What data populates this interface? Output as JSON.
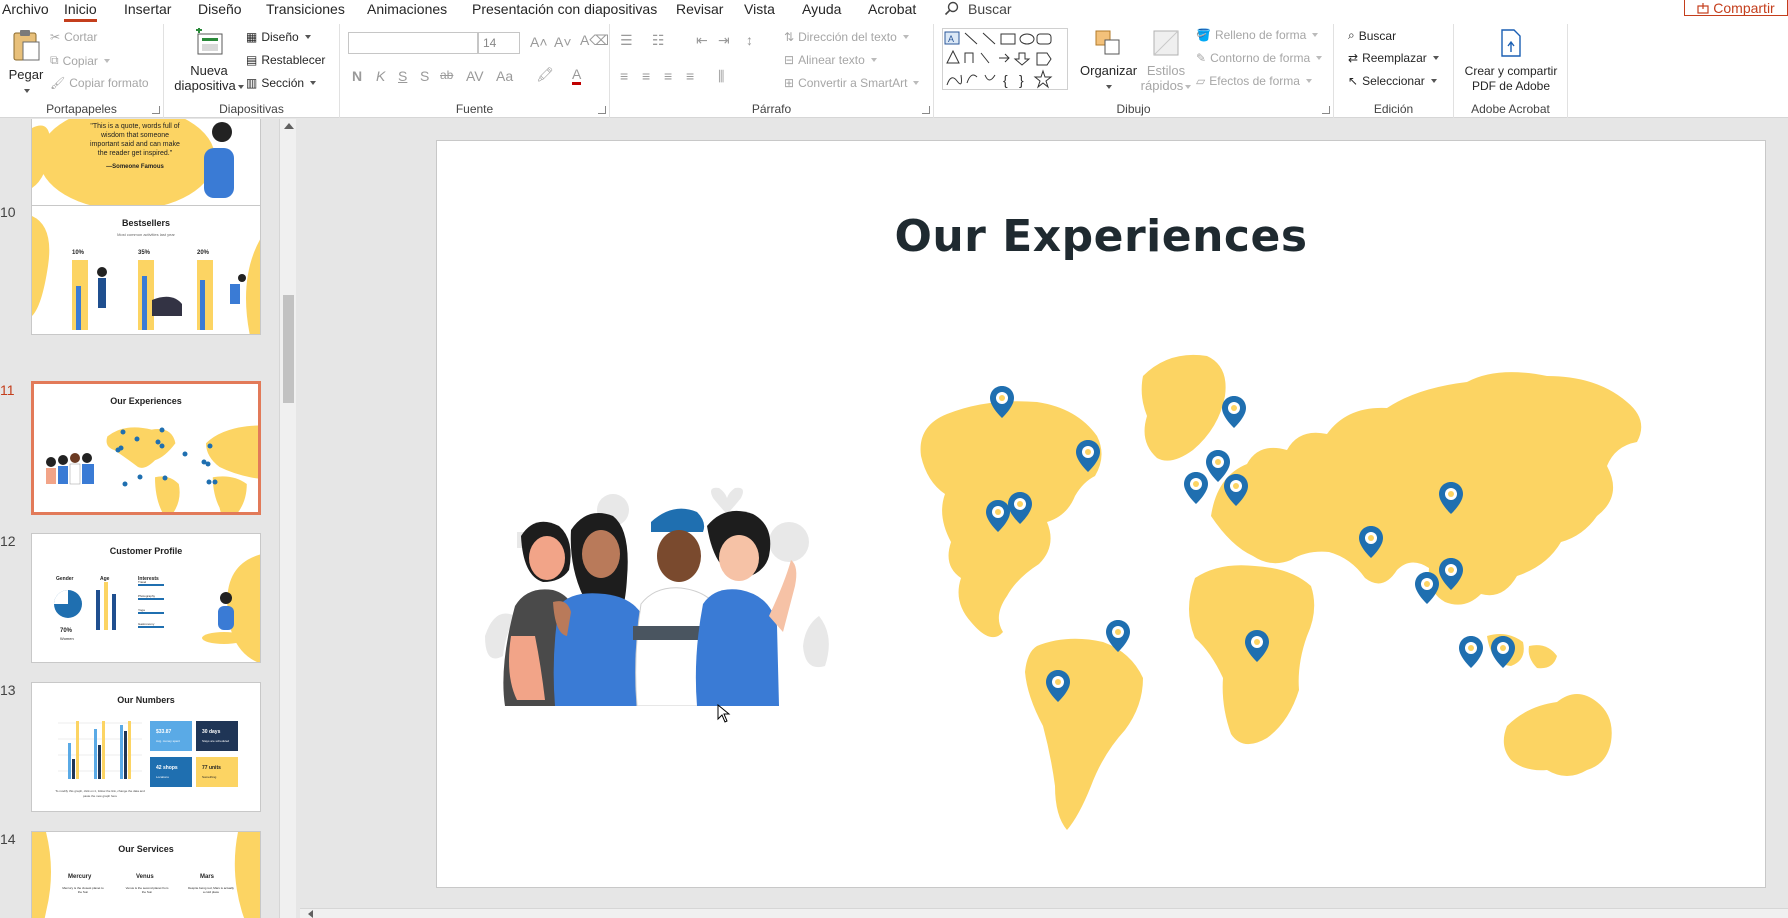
{
  "menu": {
    "tabs": [
      "Archivo",
      "Inicio",
      "Insertar",
      "Diseño",
      "Transiciones",
      "Animaciones",
      "Presentación con diapositivas",
      "Revisar",
      "Vista",
      "Ayuda",
      "Acrobat"
    ],
    "active_index": 1,
    "search_label": "Buscar",
    "share_label": "Compartir"
  },
  "ribbon": {
    "clipboard": {
      "paste": "Pegar",
      "cut": "Cortar",
      "copy": "Copiar",
      "format_painter": "Copiar formato",
      "label": "Portapapeles"
    },
    "slides": {
      "new_slide_line1": "Nueva",
      "new_slide_line2": "diapositiva",
      "layout": "Diseño",
      "reset": "Restablecer",
      "section": "Sección",
      "label": "Diapositivas"
    },
    "font": {
      "font_name": "",
      "font_size": "14",
      "bold": "N",
      "italic": "K",
      "underline": "S",
      "shadow": "S",
      "strike": "ab",
      "label": "Fuente"
    },
    "paragraph": {
      "text_direction": "Dirección del texto",
      "align_text": "Alinear texto",
      "smartart": "Convertir a SmartArt",
      "label": "Párrafo"
    },
    "drawing": {
      "arrange": "Organizar",
      "quick_styles_line1": "Estilos",
      "quick_styles_line2": "rápidos",
      "shape_fill": "Relleno de forma",
      "shape_outline": "Contorno de forma",
      "shape_effects": "Efectos de forma",
      "label": "Dibujo"
    },
    "editing": {
      "find": "Buscar",
      "replace": "Reemplazar",
      "select": "Seleccionar",
      "label": "Edición"
    },
    "acrobat": {
      "create_line1": "Crear y compartir",
      "create_line2": "PDF de Adobe",
      "label": "Adobe Acrobat"
    }
  },
  "thumbnails": [
    {
      "number": "",
      "title": "",
      "quote": "\"This is a quote, words full of wisdom that someone important said and can make the reader get inspired.\"",
      "author": "—Someone Famous"
    },
    {
      "number": "10",
      "title": "Bestsellers",
      "subtitle": "Most common activities last year",
      "bars": [
        {
          "label": "10%"
        },
        {
          "label": "35%"
        },
        {
          "label": "20%"
        }
      ]
    },
    {
      "number": "11",
      "title": "Our Experiences",
      "selected": true
    },
    {
      "number": "12",
      "title": "Customer Profile",
      "col1": "Gender",
      "col2": "Age",
      "col3": "Interests",
      "stat": "70%",
      "stat_label": "Women",
      "interests": [
        "Travel",
        "Photography",
        "Yoga",
        "Gastronomy"
      ]
    },
    {
      "number": "13",
      "title": "Our Numbers",
      "boxes": [
        {
          "big": "$33.87",
          "small": "Avg. money spent"
        },
        {
          "big": "30 days",
          "small": "Stays are scheduled"
        },
        {
          "big": "42 shops",
          "small": "Locations"
        },
        {
          "big": "77 units",
          "small": "Something"
        }
      ],
      "caption": "To modify this graph, click on it, follow the link, change the data and paste the new graph here"
    },
    {
      "number": "14",
      "title": "Our Services",
      "services": [
        {
          "name": "Mercury",
          "desc": "Mercury is the closest planet to the Sun"
        },
        {
          "name": "Venus",
          "desc": "Venus is the second planet from the Sun"
        },
        {
          "name": "Mars",
          "desc": "Despite being red, Mars is actually a cold place"
        }
      ]
    }
  ],
  "slide": {
    "title": "Our Experiences",
    "colors": {
      "map": "#fcd463",
      "pin": "#1f6fb0",
      "pin_dark": "#185a8f",
      "title": "#1f2a30"
    }
  }
}
